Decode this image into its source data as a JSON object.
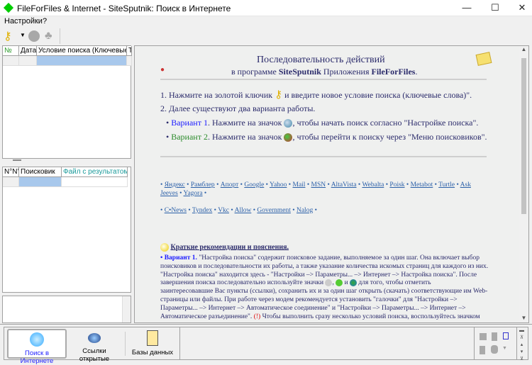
{
  "window": {
    "title": "FileForFiles & Internet - SiteSputnik: Поиск в Интернете",
    "minimize": "—",
    "maximize": "☐",
    "close": "✕"
  },
  "menu": [
    "Настройки",
    "?"
  ],
  "grid1": {
    "headers": [
      "№",
      "Дата",
      "Условие поиска (Ключевые слова)",
      "Т"
    ]
  },
  "grid2": {
    "headers": [
      "N°N°",
      "Поисковик",
      "Файл с результатом поиска"
    ]
  },
  "content": {
    "title": "Последовательность действий",
    "subtitle_pre": "в программе ",
    "subtitle_b1": "SiteSputnik",
    "subtitle_mid": " Приложения ",
    "subtitle_b2": "FileForFiles",
    "subtitle_end": ".",
    "step1_pre": "1. Нажмите на золотой ключик ",
    "step1_post": " и введите новое условие поиска (ключевые слова)\".",
    "step2": "2. Далее существуют два варианта работы.",
    "v1_label": "Вариант 1",
    "v1_text": ". Нажмите на значок ",
    "v1_post": ", чтобы начать поиск согласно \"Настройке поиска\".",
    "v2_label": "Вариант 2",
    "v2_text": ". Нажмите на значок ",
    "v2_post": ", чтобы перейти к поиску через \"Меню поисковиков\".",
    "links1": [
      "Яндекс",
      "Рамблер",
      "Апорт",
      "Google",
      "Yahoo",
      "Mail",
      "MSN",
      "AltaVista",
      "Webalta",
      "Poisk",
      "Metabot",
      "Turtle",
      "Ask Jeeves",
      "Yagora"
    ],
    "links2": [
      "C•News",
      "Tyndex",
      "Vkc",
      "Allow",
      "Government",
      "Nalog"
    ],
    "rec_title": "Краткие рекомендации и пояснения.",
    "rec_label": "• Вариант 1.",
    "rec_lines": [
      " \"Настройка поиска\" содержит поисковое задание, выполняемое за один шаг. Она включает выбор",
      "поисковиков и последовательности их работы, а также указание количества искомых страниц для каждого из них.",
      "\"Настройка поиска\" находится здесь - \"Настройки –> Параметры... –> Интернет –> Настройка поиска\". После",
      "завершения поиска последовательно используйте значки",
      "заинтересовавшие Вас пункты (ссылки), сохранить их и за один шаг открыть (скачать) соответствующие им Web-",
      "страницы или файлы. При работе через модем рекомендуется установить \"галочки\" для \"Настройки –>",
      "Параметры... –> Интернет –> Автоматическое соединение\" и \"Настройки –> Параметры... –> Интернет –>",
      "Автоматическое разъединение\". ",
      "Чтобы выполнить сразу несколько условий поиска, воспользуйтесь значком"
    ],
    "rec_icons_mid": ", ",
    "rec_icons_and": " и ",
    "rec_icons_post": " для того, чтобы отметить",
    "warn": "(!)"
  },
  "bottom": {
    "tabs": [
      "Поиск в Интернете",
      "Ссылки открытые",
      "Базы данных"
    ]
  }
}
